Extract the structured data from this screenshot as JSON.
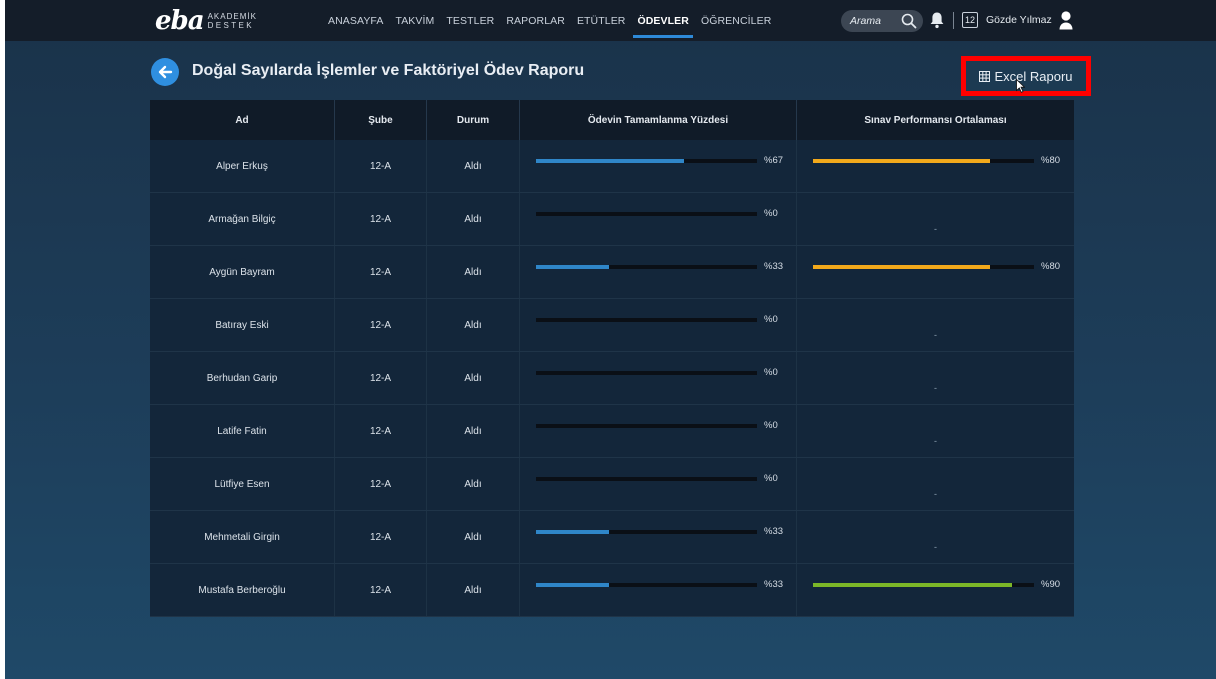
{
  "app": {
    "logo_mark": "eba",
    "logo_line1": "AKADEMİK",
    "logo_line2": "DESTEK"
  },
  "nav": {
    "items": [
      {
        "label": "ANASAYFA",
        "active": false
      },
      {
        "label": "TAKVİM",
        "active": false
      },
      {
        "label": "TESTLER",
        "active": false
      },
      {
        "label": "RAPORLAR",
        "active": false
      },
      {
        "label": "ETÜTLER",
        "active": false
      },
      {
        "label": "ÖDEVLER",
        "active": true
      },
      {
        "label": "ÖĞRENCİLER",
        "active": false
      }
    ],
    "search_label": "Arama",
    "calendar_day": "12",
    "user_name": "Gözde Yılmaz"
  },
  "page": {
    "title": "Doğal Sayılarda İşlemler ve Faktöriyel Ödev Raporu",
    "excel_button": "Excel Raporu"
  },
  "colors": {
    "accent": "#2e8ad8",
    "completion_bar": "#2f86c8",
    "performance_bar_mid": "#f2a91b",
    "performance_bar_high": "#7cb728",
    "highlight_border": "#ff0000"
  },
  "table": {
    "headers": {
      "ad": "Ad",
      "sube": "Şube",
      "durum": "Durum",
      "odev": "Ödevin Tamamlanma Yüzdesi",
      "sinav": "Sınav Performansı Ortalaması"
    },
    "rows": [
      {
        "ad": "Alper Erkuş",
        "sube": "12-A",
        "durum": "Aldı",
        "odev_label": "%67",
        "odev_value": 67,
        "sinav_label": "%80",
        "sinav_value": 80,
        "sinav_color": "#f2a91b"
      },
      {
        "ad": "Armağan Bilgiç",
        "sube": "12-A",
        "durum": "Aldı",
        "odev_label": "%0",
        "odev_value": 0,
        "sinav_label": "-",
        "sinav_value": null,
        "sinav_color": null
      },
      {
        "ad": "Aygün Bayram",
        "sube": "12-A",
        "durum": "Aldı",
        "odev_label": "%33",
        "odev_value": 33,
        "sinav_label": "%80",
        "sinav_value": 80,
        "sinav_color": "#f2a91b"
      },
      {
        "ad": "Batıray Eski",
        "sube": "12-A",
        "durum": "Aldı",
        "odev_label": "%0",
        "odev_value": 0,
        "sinav_label": "-",
        "sinav_value": null,
        "sinav_color": null
      },
      {
        "ad": "Berhudan Garip",
        "sube": "12-A",
        "durum": "Aldı",
        "odev_label": "%0",
        "odev_value": 0,
        "sinav_label": "-",
        "sinav_value": null,
        "sinav_color": null
      },
      {
        "ad": "Latife Fatin",
        "sube": "12-A",
        "durum": "Aldı",
        "odev_label": "%0",
        "odev_value": 0,
        "sinav_label": "-",
        "sinav_value": null,
        "sinav_color": null
      },
      {
        "ad": "Lütfiye Esen",
        "sube": "12-A",
        "durum": "Aldı",
        "odev_label": "%0",
        "odev_value": 0,
        "sinav_label": "-",
        "sinav_value": null,
        "sinav_color": null
      },
      {
        "ad": "Mehmetali Girgin",
        "sube": "12-A",
        "durum": "Aldı",
        "odev_label": "%33",
        "odev_value": 33,
        "sinav_label": "-",
        "sinav_value": null,
        "sinav_color": null
      },
      {
        "ad": "Mustafa Berberoğlu",
        "sube": "12-A",
        "durum": "Aldı",
        "odev_label": "%33",
        "odev_value": 33,
        "sinav_label": "%90",
        "sinav_value": 90,
        "sinav_color": "#7cb728"
      }
    ]
  }
}
